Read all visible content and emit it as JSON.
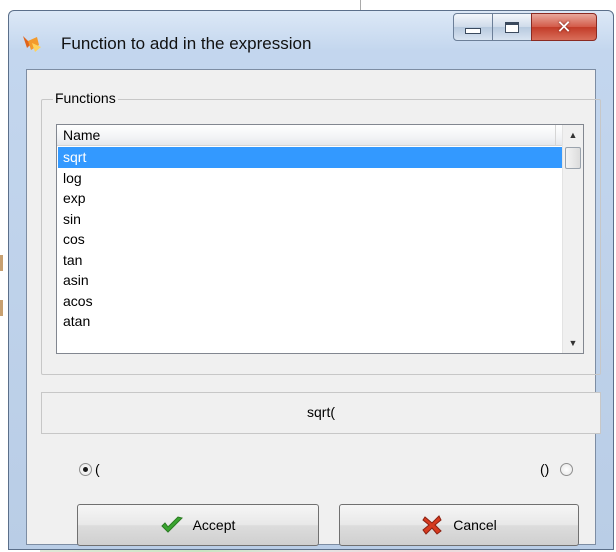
{
  "window": {
    "title": "Function to add in the expression",
    "controls": {
      "minimize": "minimize",
      "maximize": "maximize",
      "close": "close"
    }
  },
  "functions_group": {
    "label": "Functions",
    "list": {
      "column_header": "Name",
      "items": [
        "sqrt",
        "log",
        "exp",
        "sin",
        "cos",
        "tan",
        "asin",
        "acos",
        "atan"
      ],
      "selected_item": "sqrt"
    }
  },
  "expression_preview": "sqrt(",
  "options": {
    "open_paren_label": "(",
    "open_paren_selected": true,
    "pair_paren_label": "()",
    "pair_paren_selected": false
  },
  "buttons": {
    "accept_label": "Accept",
    "cancel_label": "Cancel"
  },
  "icons": {
    "app": "function-window-icon",
    "accept": "green-checkmark-icon",
    "cancel": "red-x-icon"
  },
  "colors": {
    "selection": "#3399ff",
    "close_button": "#c8392a",
    "accept_icon": "#3aa530",
    "cancel_icon": "#d63a1f"
  }
}
